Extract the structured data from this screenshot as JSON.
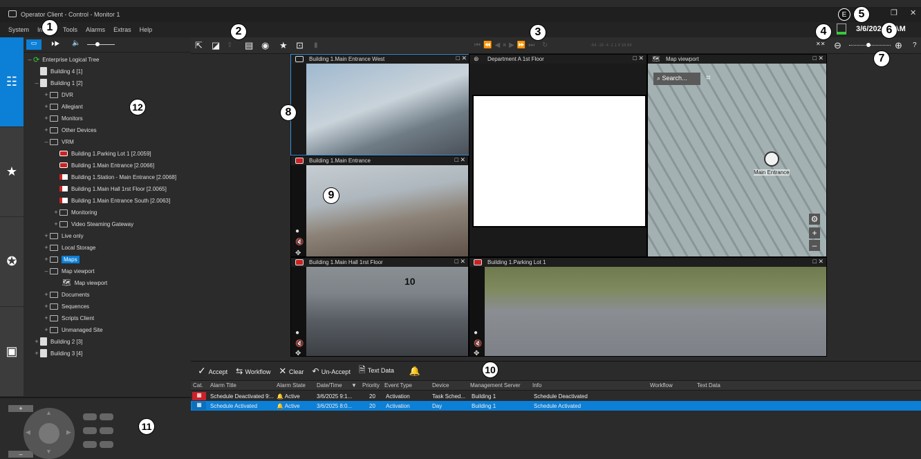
{
  "window": {
    "title": "Operator Client - Control - Monitor 1",
    "user_initial": "E",
    "datetime": "3/6/2025 9 AM"
  },
  "menu": [
    "System",
    "Image",
    "Tools",
    "Alarms",
    "Extras",
    "Help"
  ],
  "callouts": [
    "1",
    "2",
    "3",
    "4",
    "5",
    "6",
    "7",
    "8",
    "9",
    "10",
    "11",
    "12"
  ],
  "tree": {
    "root": "Enterprise Logical Tree",
    "items": [
      {
        "label": "Building 4 [1]"
      },
      {
        "label": "Building 1 [2]"
      },
      {
        "label": "DVR"
      },
      {
        "label": "Allegiant"
      },
      {
        "label": "Monitors"
      },
      {
        "label": "Other Devices"
      },
      {
        "label": "VRM"
      },
      {
        "label": "Building 1.Parking Lot 1 [2.0059]"
      },
      {
        "label": "Building 1.Main Entrance [2.0066]"
      },
      {
        "label": "Building 1.Station - Main Entrance [2.0068]"
      },
      {
        "label": "Building 1.Main Hall 1rst Floor [2.0065]"
      },
      {
        "label": "Building 1.Main Entrance South [2.0063]"
      },
      {
        "label": "Monitoring"
      },
      {
        "label": "Video Steaming Gateway"
      },
      {
        "label": "Live only"
      },
      {
        "label": "Local Storage"
      },
      {
        "label": "Maps"
      },
      {
        "label": "Map viewport"
      },
      {
        "label": "Map viewport"
      },
      {
        "label": "Documents"
      },
      {
        "label": "Sequences"
      },
      {
        "label": "Scripts Client"
      },
      {
        "label": "Unmanaged Site"
      },
      {
        "label": "Building 2 [3]"
      },
      {
        "label": "Building 3 [4]"
      }
    ]
  },
  "tiles": {
    "t1": "Building 1.Main Entrance West",
    "t2": "Department A 1st Floor",
    "t3": "Map viewport",
    "t4": "Building 1.Main Entrance",
    "t5": "Building 1.Main Hall 1rst Floor",
    "t6": "Building 1.Parking Lot 1",
    "map_search": "Search...",
    "map_marker": "Main Entrance",
    "overlay_number": "10"
  },
  "playback": {
    "speeds": "-64 -16 -4 -1  1  4  16  64"
  },
  "alarm_toolbar": {
    "accept": "Accept",
    "workflow": "Workflow",
    "clear": "Clear",
    "unaccept": "Un-Accept",
    "text_data": "Text Data"
  },
  "alarm_columns": [
    "Cat.",
    "Alarm Title",
    "Alarm State",
    "Date/Time",
    "Priority",
    "Event Type",
    "Device",
    "Management Server",
    "Info",
    "Workflow",
    "Text Data"
  ],
  "alarms": [
    {
      "title": "Schedule Deactivated 9:...",
      "state": "Active",
      "datetime": "3/6/2025 9:1...",
      "priority": "20",
      "event_type": "Activation",
      "device": "Task Sched...",
      "server": "Building 1",
      "info": "Schedule Deactivated"
    },
    {
      "title": "Schedule Activated",
      "state": "Active",
      "datetime": "3/6/2025 8:0...",
      "priority": "20",
      "event_type": "Activation",
      "device": "Day",
      "server": "Building 1",
      "info": "Schedule Activated"
    }
  ],
  "colors": {
    "accent": "#0c7fd6",
    "alarm_red": "#c8222a"
  }
}
